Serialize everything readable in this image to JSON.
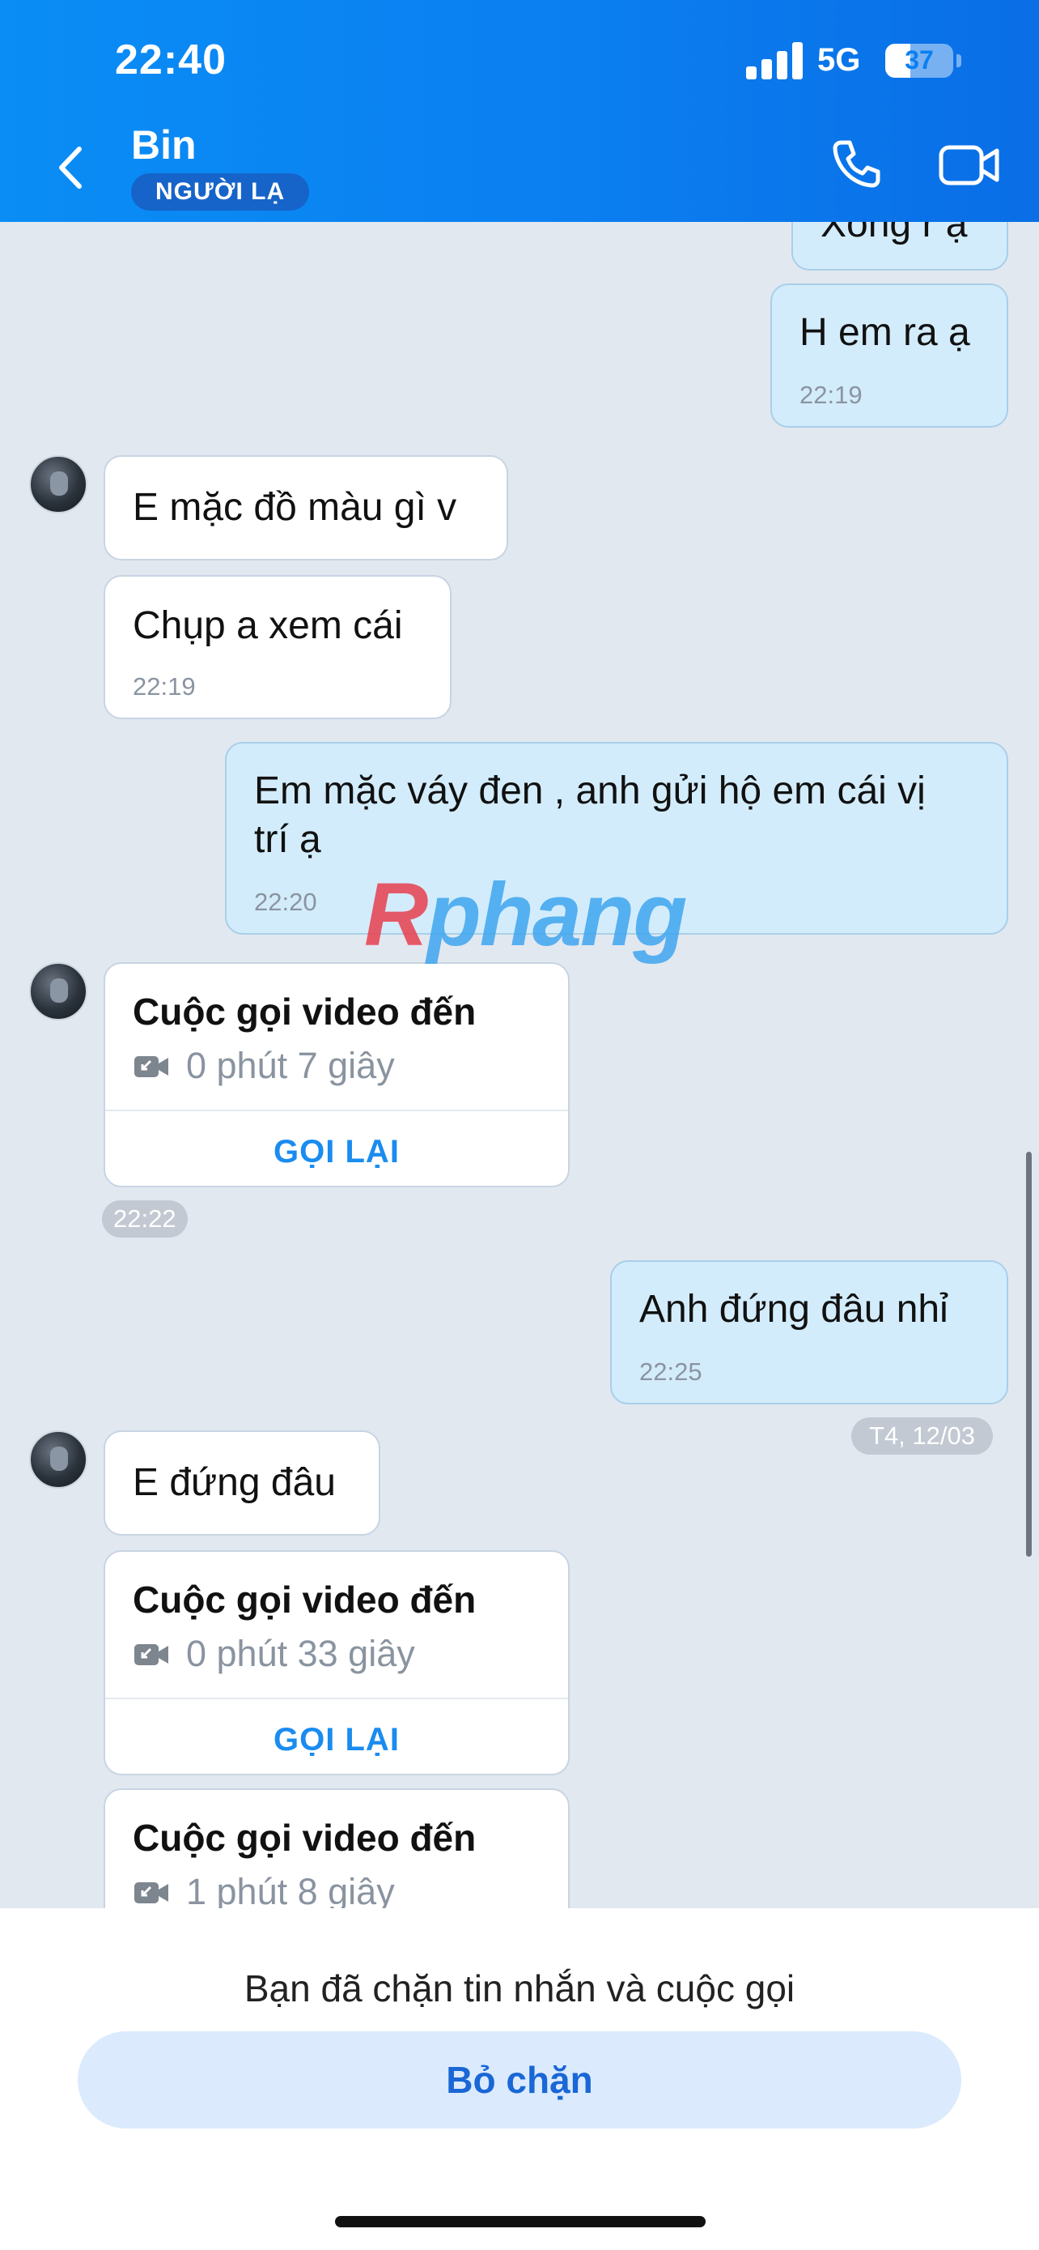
{
  "status_bar": {
    "time": "22:40",
    "network": "5G",
    "battery": "37",
    "battery_fraction": 0.37
  },
  "header": {
    "contact_name": "Bin",
    "badge": "NGƯỜI LẠ"
  },
  "messages": {
    "m0": {
      "text": "Xong r ạ"
    },
    "m1": {
      "text": "H em ra ạ",
      "time": "22:19"
    },
    "m2": {
      "text": "E mặc đồ màu gì v"
    },
    "m3": {
      "text": "Chụp a xem cái",
      "time": "22:19"
    },
    "m4": {
      "line1": "Em mặc váy đen , anh gửi hộ em cái vị",
      "line2": "trí ạ",
      "time": "22:20"
    },
    "c1": {
      "title": "Cuộc gọi video đến",
      "duration": "0 phút 7 giây",
      "action": "GỌI LẠI",
      "time": "22:22"
    },
    "m5": {
      "text": "Anh đứng đâu nhỉ",
      "time": "22:25"
    },
    "date_sep": "T4, 12/03",
    "m6": {
      "text": "E đứng đâu"
    },
    "c2": {
      "title": "Cuộc gọi video đến",
      "duration": "0 phút 33 giây",
      "action": "GỌI LẠI"
    },
    "c3": {
      "title": "Cuộc gọi video đến",
      "duration": "1 phút 8 giây"
    }
  },
  "watermark": {
    "part1": "R",
    "part2": "phang"
  },
  "footer": {
    "blocked_text": "Bạn đã chặn tin nhắn và cuộc gọi",
    "unblock_label": "Bỏ chặn"
  },
  "icons": [
    "chevron-left-icon",
    "phone-icon",
    "video-camera-icon",
    "incoming-video-call-icon"
  ],
  "colors": {
    "header": "#0b7ff0",
    "outgoing_bubble": "#d3ecfc",
    "accent": "#1a8cf0",
    "unblock_bg": "#dbeafd"
  }
}
